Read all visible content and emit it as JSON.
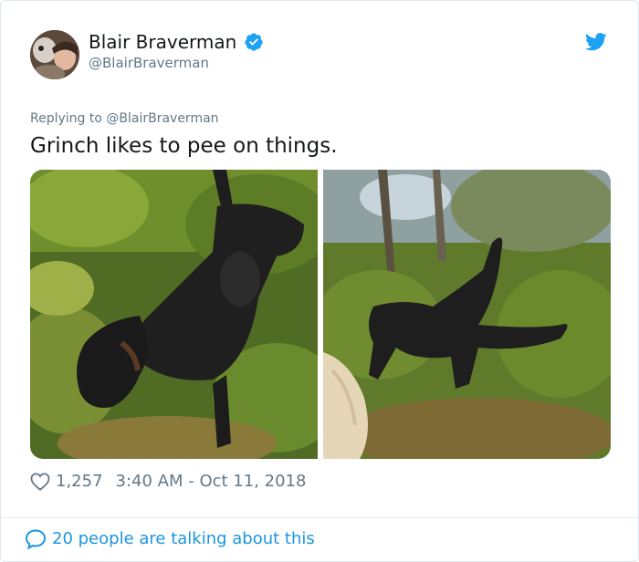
{
  "author": {
    "display_name": "Blair Braverman",
    "handle": "@BlairBraverman",
    "verified": true
  },
  "tweet": {
    "replying_to": "Replying to @BlairBraverman",
    "text": "Grinch likes to pee on things.",
    "like_count": "1,257",
    "timestamp": "3:40 AM - Oct 11, 2018"
  },
  "footer": {
    "conversation_label": "20 people are talking about this"
  },
  "media": [
    {
      "subject": "black dog sniffing in brush"
    },
    {
      "subject": "black dog lifting leg in brush"
    }
  ],
  "colors": {
    "twitter_blue": "#1da1f2",
    "link_blue": "#1b95e0",
    "muted": "#657786",
    "text": "#14171a"
  },
  "icons": {
    "verified": "verified-badge-icon",
    "brand": "twitter-bird-icon",
    "like": "heart-outline-icon",
    "conversation": "speech-bubble-icon"
  }
}
